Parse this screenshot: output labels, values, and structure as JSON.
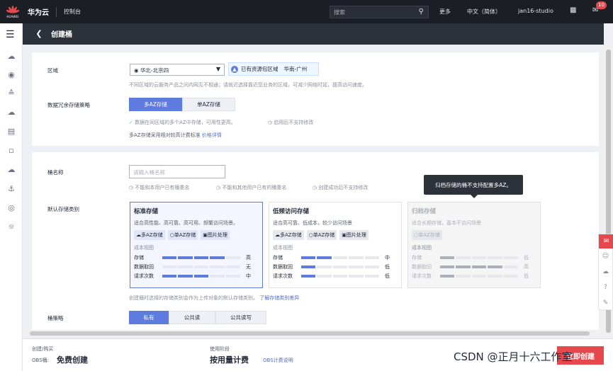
{
  "topbar": {
    "logo_text": "HUAWEI",
    "brand": "华为云",
    "console": "控制台",
    "search_placeholder": "搜索",
    "more": "更多",
    "language": "中文（简体）",
    "user": "jan16-studio",
    "notification_count": "10"
  },
  "page": {
    "title": "创建桶"
  },
  "region": {
    "label": "区域",
    "value": "华北-北京四",
    "tag_label": "已有资源包区域",
    "tag_value": "华南-广州",
    "hint": "不同区域的云服务产品之间内网互不相通；请就近选择靠近您业务的区域，可减少网络时延，提高访问速度。"
  },
  "redundancy": {
    "label": "数据冗余存储策略",
    "options": [
      "多AZ存储",
      "单AZ存储"
    ],
    "notes": [
      "数据在同区域的多个AZ中存储，可用性更高。",
      "启用后不支持修改"
    ],
    "price_hint": "多AZ存储采用相对较高计费标准",
    "price_link": "价格详情"
  },
  "bucket_name": {
    "label": "桶名称",
    "placeholder": "请输入桶名称",
    "rules": [
      "不能和本用户已有桶重名",
      "不能和其他用户已有的桶重名",
      "创建成功后不支持修改"
    ]
  },
  "tooltip": "归档存储的桶不支持配置多AZ。",
  "storage_class": {
    "label": "默认存储类别",
    "cost_view": "成本视图",
    "rows": [
      "存储",
      "数据取回",
      "请求次数"
    ],
    "cards": [
      {
        "title": "标准存储",
        "desc": "适合高性能、高可靠、高可用、频繁访问场景。",
        "chips": [
          "多AZ存储",
          "单AZ存储",
          "图片处理"
        ],
        "levels": [
          "高",
          "无",
          "中"
        ],
        "fills": [
          4,
          0,
          3
        ]
      },
      {
        "title": "低频访问存储",
        "desc": "适合高可靠、低成本，较少访问场景",
        "chips": [
          "多AZ存储",
          "单AZ存储",
          "图片处理"
        ],
        "levels": [
          "中",
          "低",
          "低"
        ],
        "fills": [
          2,
          1,
          1
        ]
      },
      {
        "title": "归档存储",
        "desc": "适合长期存储，基本不访问场景",
        "chips": [
          "单AZ存储"
        ],
        "levels": [
          "低",
          "高",
          "低"
        ],
        "fills": [
          1,
          4,
          1
        ]
      }
    ],
    "hint": "创建桶时选择的存储类别会作为上传对象的默认存储类别。",
    "hint_link": "了解存储类别差异"
  },
  "policy": {
    "label": "桶策略",
    "options": [
      "私有",
      "公共读",
      "公共读写"
    ]
  },
  "footer": {
    "create_label": "创建/购买",
    "obs_label": "OBS桶:",
    "obs_value": "免费创建",
    "stage_label": "使用阶段",
    "stage_value": "按用量计费",
    "stage_link": "OBS计费说明",
    "buy_button": "立即创建"
  },
  "watermark": "CSDN @正月十六工作室"
}
